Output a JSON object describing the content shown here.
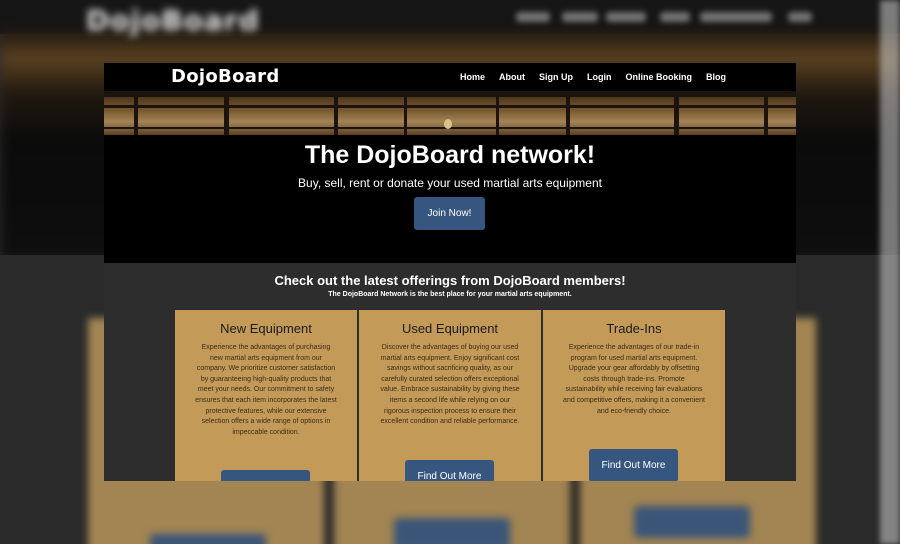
{
  "nav": {
    "logo": "DojoBoard",
    "links": [
      "Home",
      "About",
      "Sign Up",
      "Login",
      "Online Booking",
      "Blog"
    ]
  },
  "hero": {
    "title": "The DojoBoard network!",
    "subtitle": "Buy, sell, rent or donate your used martial arts equipment",
    "cta": "Join Now!"
  },
  "offerings": {
    "title": "Check out the latest offerings from DojoBoard members!",
    "subtitle": "The DojoBoard Network is the best place for your martial arts equipment.",
    "cards": [
      {
        "title": "New Equipment",
        "text": "Experience the advantages of purchasing new martial arts equipment from our company. We prioritize customer satisfaction by guaranteeing high-quality products that meet your needs. Our commitment to safety ensures that each item incorporates the latest protective features, while our extensive selection offers a wide range of options in impeccable condition.",
        "button": ""
      },
      {
        "title": "Used Equipment",
        "text": "Discover the advantages of buying our used martial arts equipment. Enjoy significant cost savings without sacrificing quality, as our carefully curated selection offers exceptional value. Embrace sustainability by giving these items a second life while relying on our rigorous inspection process to ensure their excellent condition and reliable performance.",
        "button": "Find Out More"
      },
      {
        "title": "Trade-Ins",
        "text": "Experience the advantages of our trade-in program for used martial arts equipment. Upgrade your gear affordably by offsetting costs through trade-ins. Promote sustainability while receiving fair evaluations and competitive offers, making it a convenient and eco-friendly choice.",
        "button": "Find Out More"
      }
    ]
  },
  "colors": {
    "button": "#37567f",
    "card": "#c49a59",
    "offer_bg": "#2d2d2d"
  }
}
